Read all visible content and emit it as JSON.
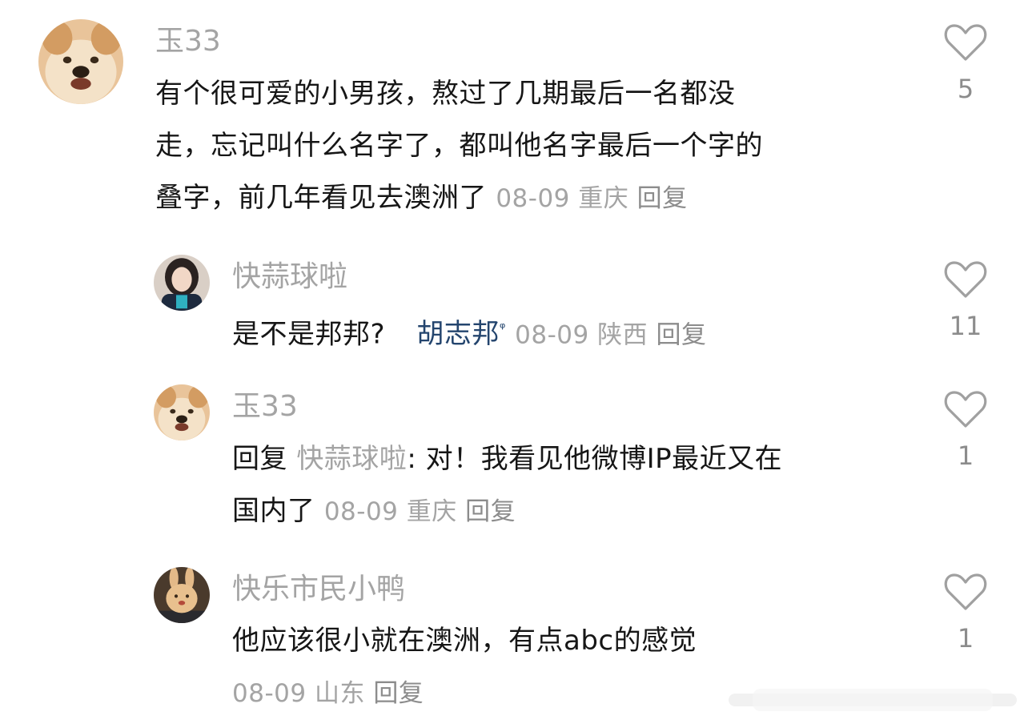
{
  "comments": [
    {
      "user": "玉33",
      "line1": "有个很可爱的小男孩，熬过了几期最后一名都没",
      "line2": "走，忘记叫什么名字了，都叫他名字最后一个字的",
      "line3": "叠字，前几年看见去澳洲了",
      "date": "08-09",
      "location": "重庆",
      "reply": "回复",
      "likes": "5"
    },
    {
      "user": "快蒜球啦",
      "text": "是不是邦邦?",
      "tag": "胡志邦",
      "tag_icon": "search-icon",
      "date": "08-09",
      "location": "陕西",
      "reply": "回复",
      "likes": "11"
    },
    {
      "user": "玉33",
      "reply_prefix": "回复",
      "reply_to": "快蒜球啦",
      "line1": ": 对！我看见他微博IP最近又在",
      "line2": "国内了",
      "date": "08-09",
      "location": "重庆",
      "reply": "回复",
      "likes": "1"
    },
    {
      "user": "快乐市民小鸭",
      "text": "他应该很小就在澳洲，有点abc的感觉",
      "date": "08-09",
      "location": "山东",
      "reply": "回复",
      "likes": "1"
    }
  ],
  "colors": {
    "username": "#a4a4a4",
    "body": "#161616",
    "meta": "#a4a4a4",
    "link": "#24456e",
    "heart": "#a0a0a0"
  }
}
